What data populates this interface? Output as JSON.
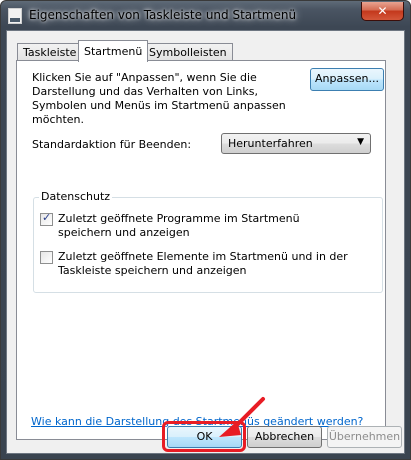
{
  "window": {
    "title": "Eigenschaften von Taskleiste und Startmenü",
    "close_glyph": "✕"
  },
  "tabs": [
    {
      "label": "Taskleiste",
      "active": false
    },
    {
      "label": "Startmenü",
      "active": true
    },
    {
      "label": "Symbolleisten",
      "active": false
    }
  ],
  "startmenu": {
    "description": "Klicken Sie auf \"Anpassen\", wenn Sie die Darstellung und das Verhalten von Links, Symbolen und Menüs im Startmenü anpassen möchten.",
    "customize_button": "Anpassen...",
    "power_label": "Standardaktion für Beenden:",
    "power_value": "Herunterfahren",
    "privacy_group": "Datenschutz",
    "checkboxes": [
      {
        "label": "Zuletzt geöffnete Programme im Startmenü speichern und anzeigen",
        "checked": true
      },
      {
        "label": "Zuletzt geöffnete Elemente im Startmenü und in der Taskleiste speichern und anzeigen",
        "checked": false
      }
    ],
    "help_link": "Wie kann die Darstellung des Startmenüs geändert werden?"
  },
  "buttons": {
    "ok": "OK",
    "cancel": "Abbrechen",
    "apply": "Übernehmen"
  },
  "annotation": {
    "color": "#e81c24"
  }
}
